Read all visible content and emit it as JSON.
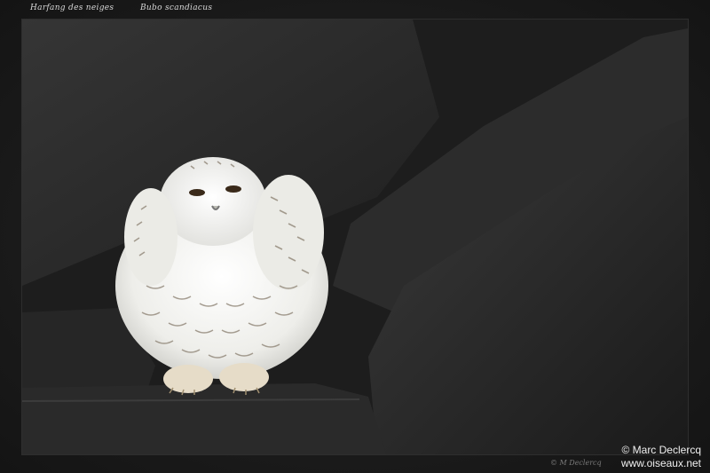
{
  "caption": {
    "common_name": "Harfang des neiges",
    "scientific_name": "Bubo scandiacus"
  },
  "credits": {
    "copyright": "© Marc Declercq",
    "website": "www.oiseaux.net",
    "small_signature": "© M Declercq"
  },
  "photo": {
    "subject": "snowy owl perched on dark rocks",
    "colors": {
      "rock_dark": "#1c1c1c",
      "rock_mid": "#2f2f2f",
      "owl_white": "#f2f2ee",
      "owl_markings": "#8a7f70"
    }
  }
}
